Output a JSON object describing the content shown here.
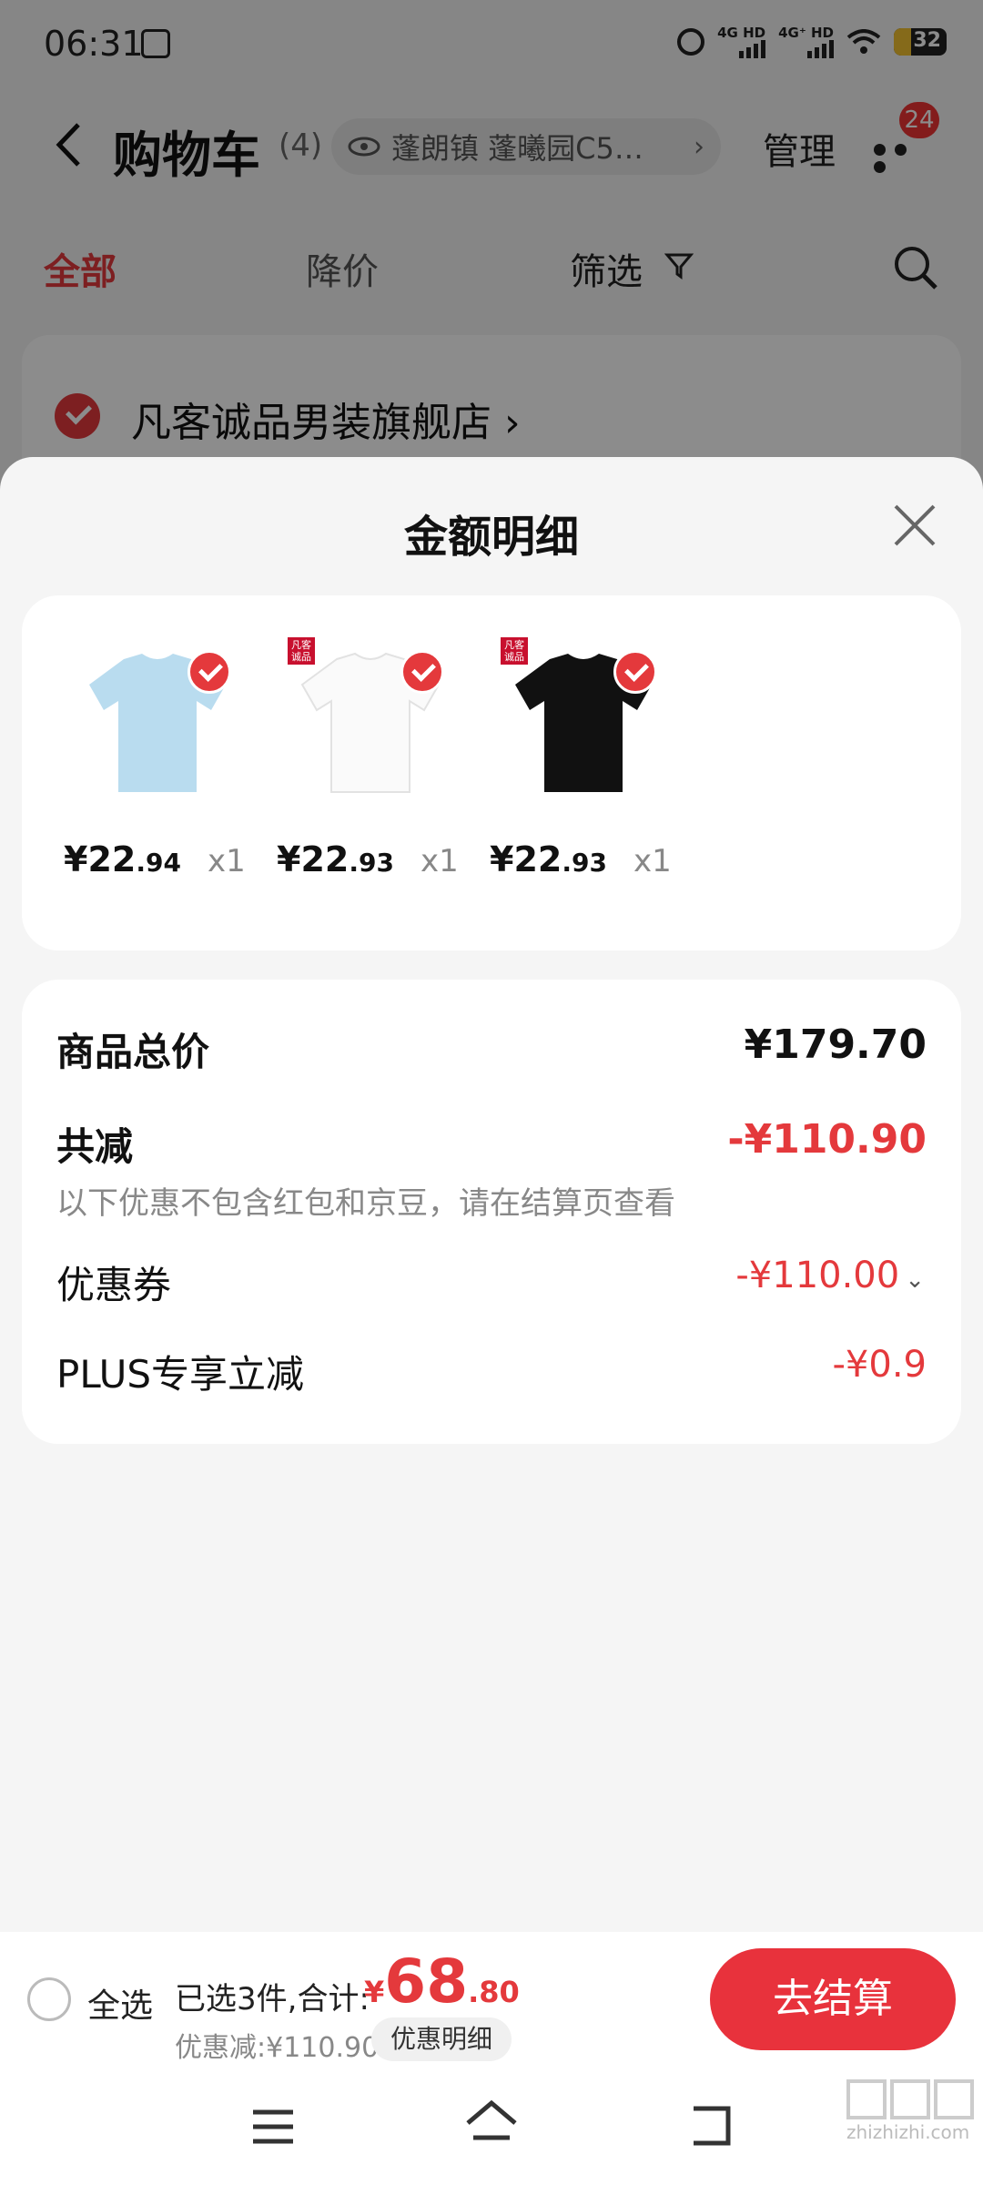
{
  "status": {
    "time": "06:31",
    "network1": "4G HD",
    "network2": "4G⁺ HD",
    "battery": "32",
    "battery_level": 0.32
  },
  "header": {
    "title": "购物车",
    "count": "(4)",
    "address": "蓬朗镇 蓬曦园C5…",
    "manage_label": "管理",
    "badge_count": "24"
  },
  "tabs": {
    "all": "全部",
    "price_drop": "降价",
    "filter": "筛选"
  },
  "store": {
    "name": "凡客诚品男装旗舰店 ›"
  },
  "sheet": {
    "title": "金额明细",
    "products": [
      {
        "color": "light-blue",
        "price_int": "¥22",
        "price_dec": ".94",
        "qty": "x1",
        "brand_tag": ""
      },
      {
        "color": "white",
        "price_int": "¥22",
        "price_dec": ".93",
        "qty": "x1",
        "brand_tag": "凡客诚品"
      },
      {
        "color": "black",
        "price_int": "¥22",
        "price_dec": ".93",
        "qty": "x1",
        "brand_tag": "凡客诚品"
      }
    ],
    "summary": {
      "total_label": "商品总价",
      "total_value": "¥179.70",
      "reduce_label": "共减",
      "reduce_value": "-¥110.90",
      "reduce_note": "以下优惠不包含红包和京豆，请在结算页查看",
      "coupon_label": "优惠券",
      "coupon_value": "-¥110.00",
      "plus_label": "PLUS专享立减",
      "plus_value": "-¥0.9"
    }
  },
  "checkout": {
    "select_all": "全选",
    "selected_text": "已选3件,合计:",
    "total_currency": "¥",
    "total_int": "68",
    "total_dec": ".80",
    "discount_text": "优惠减:¥110.90",
    "detail_button": "优惠明细",
    "checkout_button": "去结算"
  },
  "watermark": "zhizhizhi.com",
  "colors": {
    "accent": "#e4393c",
    "button": "#e8323c"
  }
}
